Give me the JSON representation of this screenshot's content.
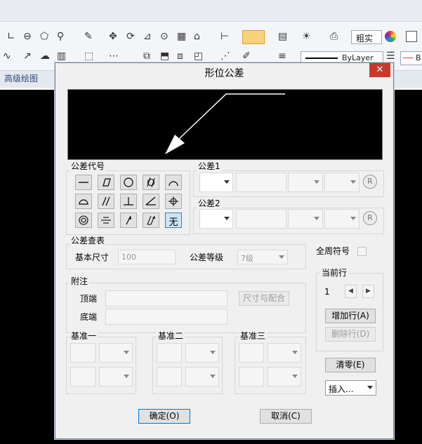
{
  "ribbon": {
    "panel_label": "高级绘图",
    "linetype_text": "粗实",
    "lineweight_text": "ByLayer",
    "color_text": "B"
  },
  "dialog": {
    "title": "形位公差",
    "close": "✕",
    "symbols_group": "公差代号",
    "tol1_group": "公差1",
    "tol2_group": "公差2",
    "r_symbol": "R",
    "lookup_group": "公差查表",
    "basic_size_label": "基本尺寸",
    "basic_size_value": "100",
    "grade_label": "公差等级",
    "grade_value": "7级",
    "note_group": "附注",
    "top_label": "顶端",
    "bottom_label": "底端",
    "fit_button": "尺寸与配合",
    "datum1_group": "基准一",
    "datum2_group": "基准二",
    "datum3_group": "基准三",
    "all_around_label": "全周符号",
    "current_row_group": "当前行",
    "current_row_value": "1",
    "add_row_button": "增加行(A)",
    "delete_row_button": "删除行(D)",
    "clear_button": "清零(E)",
    "insert_select": "插入...",
    "ok_button": "确定(O)",
    "cancel_button": "取消(C)",
    "none_symbol": "无",
    "symbols": [
      "straightness",
      "flatness",
      "circularity",
      "cylindricity",
      "line-profile",
      "surface-profile",
      "parallelism",
      "perpendicularity",
      "angularity",
      "position",
      "concentricity",
      "symmetry",
      "circular-runout",
      "total-runout",
      "none"
    ]
  }
}
